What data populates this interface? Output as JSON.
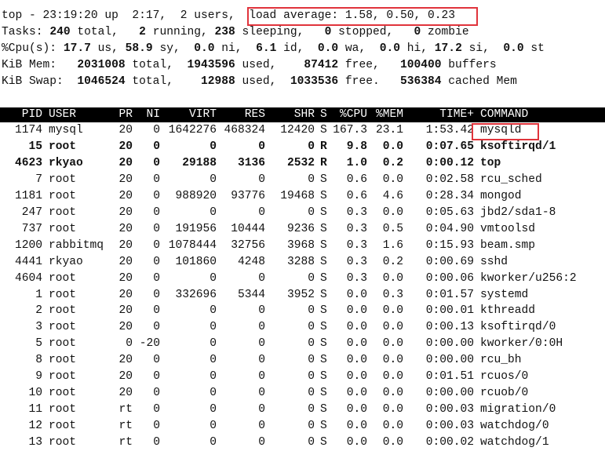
{
  "summary": {
    "line1": {
      "prefix": "top - 23:19:20 up  2:17,  2 users,  ",
      "load": "load average: 1.58, 0.50, 0.23"
    },
    "line2": [
      [
        "Tasks: ",
        0
      ],
      [
        "240",
        1
      ],
      [
        " total,   ",
        0
      ],
      [
        "2",
        1
      ],
      [
        " running, ",
        0
      ],
      [
        "238",
        1
      ],
      [
        " sleeping,   ",
        0
      ],
      [
        "0",
        1
      ],
      [
        " stopped,   ",
        0
      ],
      [
        "0",
        1
      ],
      [
        " zombie",
        0
      ]
    ],
    "line3": [
      [
        "%Cpu(s): ",
        0
      ],
      [
        "17.7",
        1
      ],
      [
        " us, ",
        0
      ],
      [
        "58.9",
        1
      ],
      [
        " sy,  ",
        0
      ],
      [
        "0.0",
        1
      ],
      [
        " ni,  ",
        0
      ],
      [
        "6.1",
        1
      ],
      [
        " id,  ",
        0
      ],
      [
        "0.0",
        1
      ],
      [
        " wa,  ",
        0
      ],
      [
        "0.0",
        1
      ],
      [
        " hi, ",
        0
      ],
      [
        "17.2",
        1
      ],
      [
        " si,  ",
        0
      ],
      [
        "0.0",
        1
      ],
      [
        " st",
        0
      ]
    ],
    "line4": [
      [
        "KiB Mem:   ",
        0
      ],
      [
        "2031008",
        1
      ],
      [
        " total,  ",
        0
      ],
      [
        "1943596",
        1
      ],
      [
        " used,    ",
        0
      ],
      [
        "87412",
        1
      ],
      [
        " free,   ",
        0
      ],
      [
        "100400",
        1
      ],
      [
        " buffers",
        0
      ]
    ],
    "line5": [
      [
        "KiB Swap:  ",
        0
      ],
      [
        "1046524",
        1
      ],
      [
        " total,    ",
        0
      ],
      [
        "12988",
        1
      ],
      [
        " used,  ",
        0
      ],
      [
        "1033536",
        1
      ],
      [
        " free.   ",
        0
      ],
      [
        "536384",
        1
      ],
      [
        " cached Mem",
        0
      ]
    ]
  },
  "columns": [
    "PID",
    "USER",
    "PR",
    "NI",
    "VIRT",
    "RES",
    "SHR",
    "S",
    "%CPU",
    "%MEM",
    "TIME+",
    "COMMAND"
  ],
  "processes": [
    {
      "pid": "1174",
      "user": "mysql",
      "pr": "20",
      "ni": "0",
      "virt": "1642276",
      "res": "468324",
      "shr": "12420",
      "s": "S",
      "cpu": "167.3",
      "mem": "23.1",
      "time": "1:53.42",
      "cmd": "mysqld",
      "bold": false,
      "highlight": true
    },
    {
      "pid": "15",
      "user": "root",
      "pr": "20",
      "ni": "0",
      "virt": "0",
      "res": "0",
      "shr": "0",
      "s": "R",
      "cpu": "9.8",
      "mem": "0.0",
      "time": "0:07.65",
      "cmd": "ksoftirqd/1",
      "bold": true
    },
    {
      "pid": "4623",
      "user": "rkyao",
      "pr": "20",
      "ni": "0",
      "virt": "29188",
      "res": "3136",
      "shr": "2532",
      "s": "R",
      "cpu": "1.0",
      "mem": "0.2",
      "time": "0:00.12",
      "cmd": "top",
      "bold": true
    },
    {
      "pid": "7",
      "user": "root",
      "pr": "20",
      "ni": "0",
      "virt": "0",
      "res": "0",
      "shr": "0",
      "s": "S",
      "cpu": "0.6",
      "mem": "0.0",
      "time": "0:02.58",
      "cmd": "rcu_sched"
    },
    {
      "pid": "1181",
      "user": "root",
      "pr": "20",
      "ni": "0",
      "virt": "988920",
      "res": "93776",
      "shr": "19468",
      "s": "S",
      "cpu": "0.6",
      "mem": "4.6",
      "time": "0:28.34",
      "cmd": "mongod"
    },
    {
      "pid": "247",
      "user": "root",
      "pr": "20",
      "ni": "0",
      "virt": "0",
      "res": "0",
      "shr": "0",
      "s": "S",
      "cpu": "0.3",
      "mem": "0.0",
      "time": "0:05.63",
      "cmd": "jbd2/sda1-8"
    },
    {
      "pid": "737",
      "user": "root",
      "pr": "20",
      "ni": "0",
      "virt": "191956",
      "res": "10444",
      "shr": "9236",
      "s": "S",
      "cpu": "0.3",
      "mem": "0.5",
      "time": "0:04.90",
      "cmd": "vmtoolsd"
    },
    {
      "pid": "1200",
      "user": "rabbitmq",
      "pr": "20",
      "ni": "0",
      "virt": "1078444",
      "res": "32756",
      "shr": "3968",
      "s": "S",
      "cpu": "0.3",
      "mem": "1.6",
      "time": "0:15.93",
      "cmd": "beam.smp"
    },
    {
      "pid": "4441",
      "user": "rkyao",
      "pr": "20",
      "ni": "0",
      "virt": "101860",
      "res": "4248",
      "shr": "3288",
      "s": "S",
      "cpu": "0.3",
      "mem": "0.2",
      "time": "0:00.69",
      "cmd": "sshd"
    },
    {
      "pid": "4604",
      "user": "root",
      "pr": "20",
      "ni": "0",
      "virt": "0",
      "res": "0",
      "shr": "0",
      "s": "S",
      "cpu": "0.3",
      "mem": "0.0",
      "time": "0:00.06",
      "cmd": "kworker/u256:2"
    },
    {
      "pid": "1",
      "user": "root",
      "pr": "20",
      "ni": "0",
      "virt": "332696",
      "res": "5344",
      "shr": "3952",
      "s": "S",
      "cpu": "0.0",
      "mem": "0.3",
      "time": "0:01.57",
      "cmd": "systemd"
    },
    {
      "pid": "2",
      "user": "root",
      "pr": "20",
      "ni": "0",
      "virt": "0",
      "res": "0",
      "shr": "0",
      "s": "S",
      "cpu": "0.0",
      "mem": "0.0",
      "time": "0:00.01",
      "cmd": "kthreadd"
    },
    {
      "pid": "3",
      "user": "root",
      "pr": "20",
      "ni": "0",
      "virt": "0",
      "res": "0",
      "shr": "0",
      "s": "S",
      "cpu": "0.0",
      "mem": "0.0",
      "time": "0:00.13",
      "cmd": "ksoftirqd/0"
    },
    {
      "pid": "5",
      "user": "root",
      "pr": "0",
      "ni": "-20",
      "virt": "0",
      "res": "0",
      "shr": "0",
      "s": "S",
      "cpu": "0.0",
      "mem": "0.0",
      "time": "0:00.00",
      "cmd": "kworker/0:0H"
    },
    {
      "pid": "8",
      "user": "root",
      "pr": "20",
      "ni": "0",
      "virt": "0",
      "res": "0",
      "shr": "0",
      "s": "S",
      "cpu": "0.0",
      "mem": "0.0",
      "time": "0:00.00",
      "cmd": "rcu_bh"
    },
    {
      "pid": "9",
      "user": "root",
      "pr": "20",
      "ni": "0",
      "virt": "0",
      "res": "0",
      "shr": "0",
      "s": "S",
      "cpu": "0.0",
      "mem": "0.0",
      "time": "0:01.51",
      "cmd": "rcuos/0"
    },
    {
      "pid": "10",
      "user": "root",
      "pr": "20",
      "ni": "0",
      "virt": "0",
      "res": "0",
      "shr": "0",
      "s": "S",
      "cpu": "0.0",
      "mem": "0.0",
      "time": "0:00.00",
      "cmd": "rcuob/0"
    },
    {
      "pid": "11",
      "user": "root",
      "pr": "rt",
      "ni": "0",
      "virt": "0",
      "res": "0",
      "shr": "0",
      "s": "S",
      "cpu": "0.0",
      "mem": "0.0",
      "time": "0:00.03",
      "cmd": "migration/0"
    },
    {
      "pid": "12",
      "user": "root",
      "pr": "rt",
      "ni": "0",
      "virt": "0",
      "res": "0",
      "shr": "0",
      "s": "S",
      "cpu": "0.0",
      "mem": "0.0",
      "time": "0:00.03",
      "cmd": "watchdog/0"
    },
    {
      "pid": "13",
      "user": "root",
      "pr": "rt",
      "ni": "0",
      "virt": "0",
      "res": "0",
      "shr": "0",
      "s": "S",
      "cpu": "0.0",
      "mem": "0.0",
      "time": "0:00.02",
      "cmd": "watchdog/1"
    }
  ],
  "colors": {
    "highlight_box": "#e0343c",
    "header_bg": "#000000",
    "header_fg": "#ffffff"
  }
}
